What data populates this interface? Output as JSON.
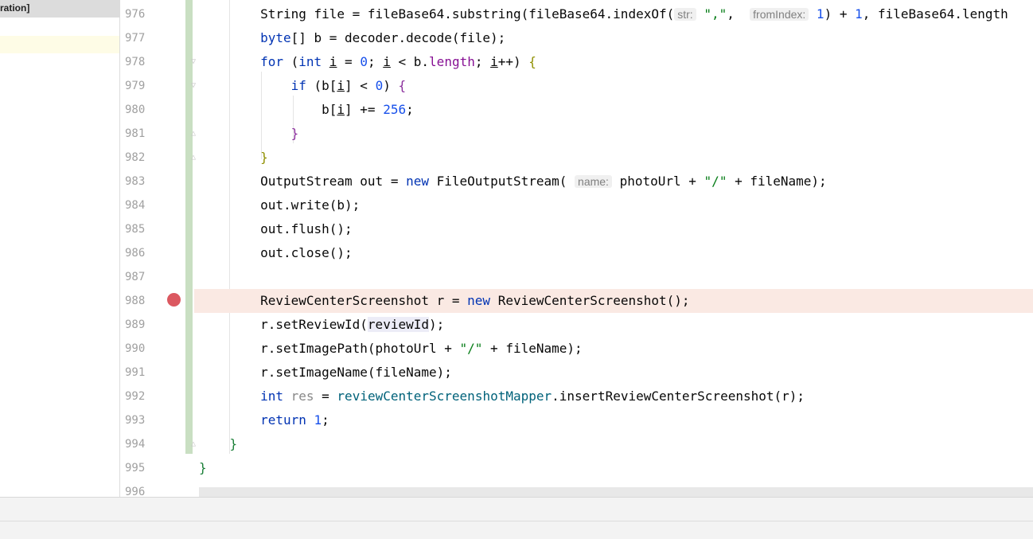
{
  "left_panel": {
    "tab_label": "ration]"
  },
  "gutter": {
    "line_numbers": [
      "976",
      "977",
      "978",
      "979",
      "980",
      "981",
      "982",
      "983",
      "984",
      "985",
      "986",
      "987",
      "988",
      "989",
      "990",
      "991",
      "992",
      "993",
      "994",
      "995",
      "996"
    ]
  },
  "code": {
    "lines": [
      [
        {
          "t": "        String file = fileBase64.substring(fileBase64.indexOf("
        },
        {
          "h": "str:"
        },
        {
          "t": " "
        },
        {
          "t": "\",\"",
          "c": "str"
        },
        {
          "t": ",  "
        },
        {
          "h": "fromIndex:"
        },
        {
          "t": " "
        },
        {
          "t": "1",
          "c": "num"
        },
        {
          "t": ") + "
        },
        {
          "t": "1",
          "c": "num"
        },
        {
          "t": ", fileBase64.length"
        }
      ],
      [
        {
          "t": "        "
        },
        {
          "t": "byte",
          "c": "kw"
        },
        {
          "t": "[] b = decoder.decode(file);"
        }
      ],
      [
        {
          "t": "        "
        },
        {
          "t": "for",
          "c": "kw"
        },
        {
          "t": " ("
        },
        {
          "t": "int",
          "c": "kw"
        },
        {
          "t": " "
        },
        {
          "t": "i",
          "c": "u"
        },
        {
          "t": " = "
        },
        {
          "t": "0",
          "c": "num"
        },
        {
          "t": "; "
        },
        {
          "t": "i",
          "c": "u"
        },
        {
          "t": " < b."
        },
        {
          "t": "length",
          "c": "field"
        },
        {
          "t": "; "
        },
        {
          "t": "i",
          "c": "u"
        },
        {
          "t": "++) "
        },
        {
          "t": "{",
          "c": "p1"
        }
      ],
      [
        {
          "t": "            "
        },
        {
          "t": "if",
          "c": "kw"
        },
        {
          "t": " (b["
        },
        {
          "t": "i",
          "c": "u"
        },
        {
          "t": "] < "
        },
        {
          "t": "0",
          "c": "num"
        },
        {
          "t": ") "
        },
        {
          "t": "{",
          "c": "p2"
        }
      ],
      [
        {
          "t": "                b["
        },
        {
          "t": "i",
          "c": "u"
        },
        {
          "t": "] += "
        },
        {
          "t": "256",
          "c": "num"
        },
        {
          "t": ";"
        }
      ],
      [
        {
          "t": "            "
        },
        {
          "t": "}",
          "c": "p2"
        }
      ],
      [
        {
          "t": "        "
        },
        {
          "t": "}",
          "c": "p1"
        }
      ],
      [
        {
          "t": "        OutputStream out = "
        },
        {
          "t": "new",
          "c": "kw"
        },
        {
          "t": " FileOutputStream( "
        },
        {
          "h": "name:"
        },
        {
          "t": " photoUrl + "
        },
        {
          "t": "\"/\"",
          "c": "str"
        },
        {
          "t": " + fileName);"
        }
      ],
      [
        {
          "t": "        out.write(b);"
        }
      ],
      [
        {
          "t": "        out.flush();"
        }
      ],
      [
        {
          "t": "        out.close();"
        }
      ],
      [
        {
          "t": ""
        }
      ],
      [
        {
          "t": "        ReviewCenterScreenshot r = "
        },
        {
          "t": "new",
          "c": "kw"
        },
        {
          "t": " ReviewCenterScreenshot();"
        }
      ],
      [
        {
          "t": "        r.setReviewId("
        },
        {
          "t": "reviewId",
          "c": "hl-var"
        },
        {
          "t": ");"
        }
      ],
      [
        {
          "t": "        r.setImagePath(photoUrl + "
        },
        {
          "t": "\"/\"",
          "c": "str"
        },
        {
          "t": " + fileName);"
        }
      ],
      [
        {
          "t": "        r.setImageName(fileName);"
        }
      ],
      [
        {
          "t": "        "
        },
        {
          "t": "int",
          "c": "kw"
        },
        {
          "t": " "
        },
        {
          "t": "res",
          "c": "unused"
        },
        {
          "t": " = "
        },
        {
          "t": "reviewCenterScreenshotMapper",
          "c": "fn"
        },
        {
          "t": ".insertReviewCenterScreenshot(r);"
        }
      ],
      [
        {
          "t": "        "
        },
        {
          "t": "return",
          "c": "kw"
        },
        {
          "t": " "
        },
        {
          "t": "1",
          "c": "num"
        },
        {
          "t": ";"
        }
      ],
      [
        {
          "t": "    "
        },
        {
          "t": "}",
          "c": "p3"
        }
      ],
      [
        {
          "t": ""
        },
        {
          "t": "}",
          "c": "p3"
        }
      ],
      [
        {
          "t": ""
        }
      ]
    ]
  },
  "breakpoint": {
    "line": "988",
    "icon": "breakpoint-icon",
    "color": "#db5860"
  },
  "colors": {
    "keyword": "#0033b3",
    "number": "#1750eb",
    "string": "#067d17",
    "breakpoint_line_bg": "#fae9e3",
    "change_bar": "#c9dfc2"
  }
}
